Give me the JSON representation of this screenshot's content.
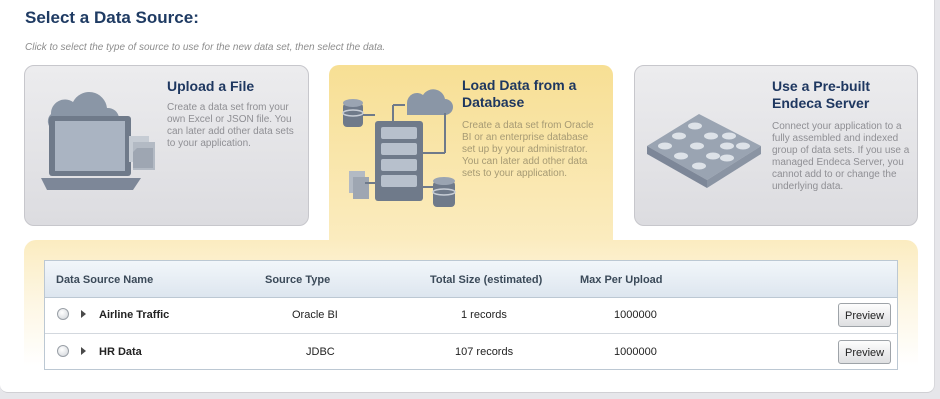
{
  "header": {
    "title": "Select a Data Source:",
    "subtitle": "Click to select the type of source to use for the new data set, then select the data."
  },
  "source_types": [
    {
      "title": "Upload a File",
      "description": "Create a data set from your own Excel or JSON file. You can later add other data sets to your application.",
      "icon": "laptop-upload-icon",
      "selected": false
    },
    {
      "title": "Load Data from a Database",
      "description": "Create a data set from Oracle BI or an enterprise database set up by your administrator. You can later add other data sets to your application.",
      "icon": "database-network-icon",
      "selected": true
    },
    {
      "title": "Use a Pre-built Endeca Server",
      "description": "Connect your application to a fully assembled and indexed group of data sets. If you use a managed Endeca Server, you cannot add to or change the underlying data.",
      "icon": "server-grid-icon",
      "selected": false
    }
  ],
  "table": {
    "columns": [
      "Data Source Name",
      "Source Type",
      "Total Size (estimated)",
      "Max Per Upload"
    ],
    "rows": [
      {
        "name": "Airline Traffic",
        "type": "Oracle BI",
        "size": "1 records",
        "max": "1000000",
        "action": "Preview"
      },
      {
        "name": "HR Data",
        "type": "JDBC",
        "size": "107 records",
        "max": "1000000",
        "action": "Preview"
      }
    ]
  },
  "colors": {
    "title": "#1f3b63",
    "selected_card": "#f7df94",
    "card": "#e4e4e7"
  }
}
